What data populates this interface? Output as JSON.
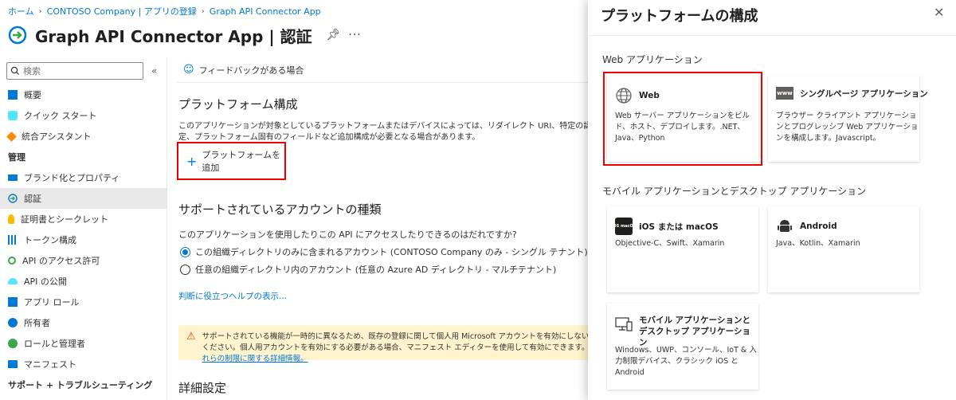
{
  "breadcrumb": [
    "ホーム",
    "CONTOSO Company | アプリの登録",
    "Graph API Connector App"
  ],
  "title": "Graph API Connector App | 認証",
  "search": {
    "placeholder": "検索"
  },
  "nav": {
    "items_top": [
      "概要",
      "クイック スタート",
      "統合アシスタント"
    ],
    "section_manage": "管理",
    "items_manage": [
      "ブランド化とプロパティ",
      "認証",
      "証明書とシークレット",
      "トークン構成",
      "API のアクセス許可",
      "API の公開",
      "アプリ ロール",
      "所有者",
      "ロールと管理者",
      "マニフェスト"
    ],
    "section_support": "サポート + トラブルシューティング"
  },
  "main": {
    "feedback": "フィードバックがある場合",
    "platform_title": "プラットフォーム構成",
    "platform_desc": "このアプリケーションが対象としているプラットフォームまたはデバイスによっては、リダイレクト URI、特定の認証設定、プラットフォーム固有のフィールドなど追加構成が必要となる場合があります。",
    "add_platform": "プラットフォームを追加",
    "accounts_title": "サポートされているアカウントの種類",
    "accounts_question": "このアプリケーションを使用したりこの API にアクセスしたりできるのはだれですか?",
    "option1": "この組織ディレクトリのみに含まれるアカウント (CONTOSO Company のみ - シングル テナント)",
    "option2": "任意の組織ディレクトリ内のアカウント (任意の Azure AD ディレクトリ - マルチテナント)",
    "help_link": "判断に役立つヘルプの表示...",
    "warning_text": "サポートされている機能が一時的に異なるため、既存の登録に関して個人用 Microsoft アカウントを有効にしないでください。個人用アカウントを有効にする必要がある場合、マニフェスト エディターを使用して有効にできます。",
    "warning_link": "これらの制限に関する詳細情報。",
    "advanced_title": "詳細設定"
  },
  "panel": {
    "title": "プラットフォームの構成",
    "web_group": "Web アプリケーション",
    "mobile_group": "モバイル アプリケーションとデスクトップ アプリケーション",
    "cards": {
      "web": {
        "title": "Web",
        "desc": "Web サーバー アプリケーションをビルド、ホスト、デプロイします。.NET、Java、Python"
      },
      "spa": {
        "title": "シングルページ アプリケーション",
        "desc": "ブラウザー クライアント アプリケーションとプログレッシブ Web アプリケーションを構成します。Javascript。",
        "icon_text": "www"
      },
      "ios": {
        "title": "iOS または macOS",
        "desc": "Objective-C、Swift、Xamarin",
        "icon_text": "iOS macOS"
      },
      "android": {
        "title": "Android",
        "desc": "Java、Kotlin、Xamarin"
      },
      "desktop": {
        "title": "モバイル アプリケーションとデスクトップ アプリケーション",
        "desc": "Windows、UWP、コンソール、IoT & 入力制限デバイス、クラシック iOS と Android"
      }
    }
  },
  "colors": {
    "accent": "#0078d4",
    "highlight": "#e00000",
    "warning_bg": "#fff4ce"
  }
}
